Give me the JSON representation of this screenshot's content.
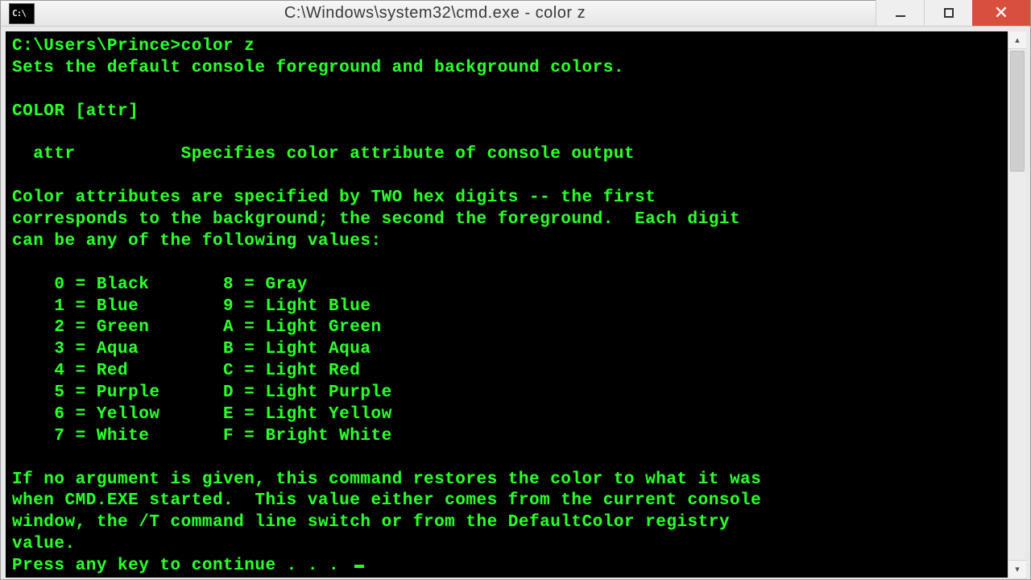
{
  "window": {
    "title": "C:\\Windows\\system32\\cmd.exe - color  z",
    "icon_label": "C:\\"
  },
  "console": {
    "prompt": "C:\\Users\\Prince>",
    "command": "color z",
    "help": {
      "line1": "Sets the default console foreground and background colors.",
      "syntax": "COLOR [attr]",
      "attr_label": "attr",
      "attr_desc": "Specifies color attribute of console output",
      "desc1": "Color attributes are specified by TWO hex digits -- the first",
      "desc2": "corresponds to the background; the second the foreground.  Each digit",
      "desc3": "can be any of the following values:",
      "colors_left": [
        {
          "code": "0",
          "name": "Black"
        },
        {
          "code": "1",
          "name": "Blue"
        },
        {
          "code": "2",
          "name": "Green"
        },
        {
          "code": "3",
          "name": "Aqua"
        },
        {
          "code": "4",
          "name": "Red"
        },
        {
          "code": "5",
          "name": "Purple"
        },
        {
          "code": "6",
          "name": "Yellow"
        },
        {
          "code": "7",
          "name": "White"
        }
      ],
      "colors_right": [
        {
          "code": "8",
          "name": "Gray"
        },
        {
          "code": "9",
          "name": "Light Blue"
        },
        {
          "code": "A",
          "name": "Light Green"
        },
        {
          "code": "B",
          "name": "Light Aqua"
        },
        {
          "code": "C",
          "name": "Light Red"
        },
        {
          "code": "D",
          "name": "Light Purple"
        },
        {
          "code": "E",
          "name": "Light Yellow"
        },
        {
          "code": "F",
          "name": "Bright White"
        }
      ],
      "footer1": "If no argument is given, this command restores the color to what it was",
      "footer2": "when CMD.EXE started.  This value either comes from the current console",
      "footer3": "window, the /T command line switch or from the DefaultColor registry",
      "footer4": "value.",
      "press": "Press any key to continue . . ."
    }
  }
}
